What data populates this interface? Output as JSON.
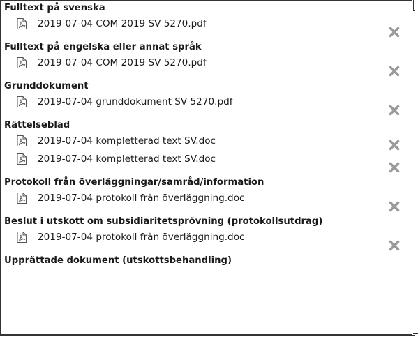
{
  "sections": [
    {
      "heading": "Fulltext på svenska",
      "files": [
        {
          "name": "2019-07-04 COM 2019 SV 5270.pdf",
          "icon": "pdf-file-icon",
          "remove_icon": "remove-icon"
        }
      ]
    },
    {
      "heading": "Fulltext på engelska eller annat språk",
      "files": [
        {
          "name": "2019-07-04 COM 2019 SV 5270.pdf",
          "icon": "pdf-file-icon",
          "remove_icon": "remove-icon"
        }
      ]
    },
    {
      "heading": "Grunddokument",
      "files": [
        {
          "name": "2019-07-04 grunddokument SV 5270.pdf",
          "icon": "pdf-file-icon",
          "remove_icon": "remove-icon"
        }
      ]
    },
    {
      "heading": "Rättelseblad",
      "files": [
        {
          "name": "2019-07-04 kompletterad text SV.doc",
          "icon": "pdf-file-icon",
          "remove_icon": "remove-icon"
        },
        {
          "name": "2019-07-04 kompletterad text SV.doc",
          "icon": "pdf-file-icon",
          "remove_icon": "remove-icon"
        }
      ]
    },
    {
      "heading": "Protokoll från överläggningar/samråd/information",
      "files": [
        {
          "name": "2019-07-04 protokoll från överläggning.doc",
          "icon": "pdf-file-icon",
          "remove_icon": "remove-icon"
        }
      ]
    },
    {
      "heading": "Beslut i utskott om subsidiaritetsprövning (protokollsutdrag)",
      "files": [
        {
          "name": "2019-07-04 protokoll från överläggning.doc",
          "icon": "pdf-file-icon",
          "remove_icon": "remove-icon"
        }
      ]
    },
    {
      "heading": "Upprättade dokument (utskottsbehandling)",
      "files": []
    }
  ],
  "colors": {
    "text": "#1a1a1a",
    "icon": "#555555",
    "remove": "#9a9a9a",
    "border": "#333333"
  }
}
